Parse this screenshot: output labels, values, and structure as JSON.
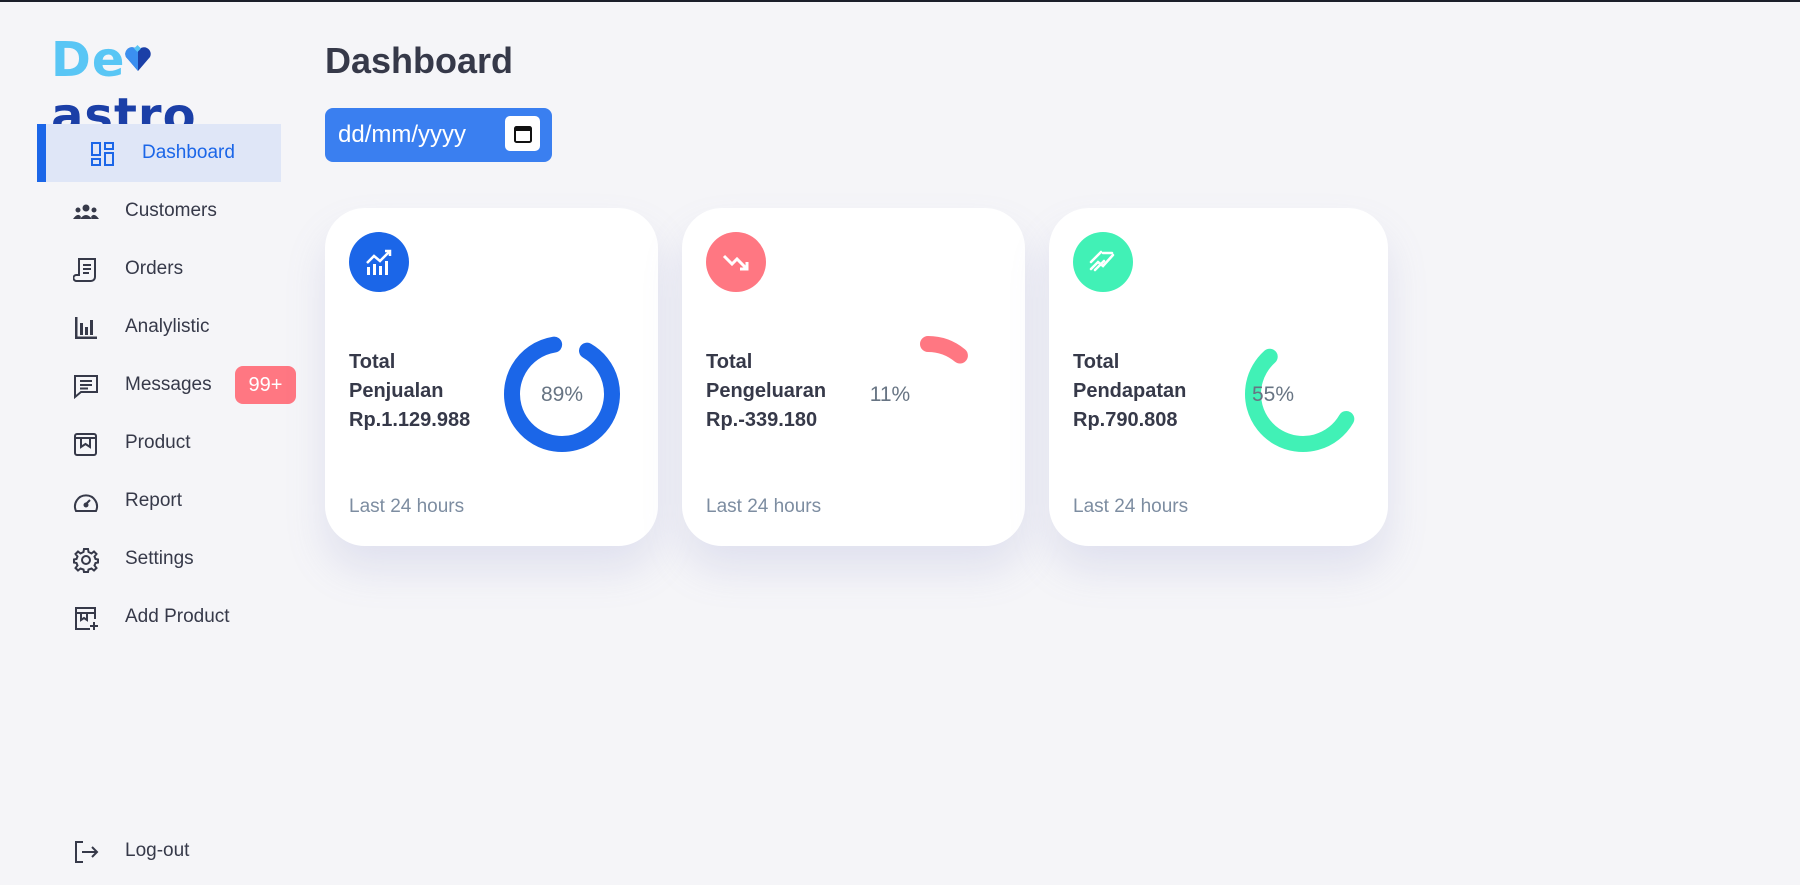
{
  "logo": {
    "part1": "De",
    "part2": "astro",
    "dot": "."
  },
  "nav": [
    {
      "label": "Dashboard",
      "icon": "grid-icon"
    },
    {
      "label": "Customers",
      "icon": "users-icon"
    },
    {
      "label": "Orders",
      "icon": "receipt-icon"
    },
    {
      "label": "Analylistic",
      "icon": "bar-chart-icon"
    },
    {
      "label": "Messages",
      "icon": "message-icon",
      "badge": "99+"
    },
    {
      "label": "Product",
      "icon": "product-icon"
    },
    {
      "label": "Report",
      "icon": "report-icon"
    },
    {
      "label": "Settings",
      "icon": "gear-icon"
    },
    {
      "label": "Add Product",
      "icon": "add-product-icon"
    }
  ],
  "logout": {
    "label": "Log-out",
    "icon": "logout-icon"
  },
  "header": {
    "title": "Dashboard"
  },
  "date_input": {
    "placeholder": "dd/mm/yyyy"
  },
  "cards": [
    {
      "line1": "Total",
      "line2": "Penjualan",
      "amount": "Rp.1.129.988",
      "percent": "89%",
      "progress": 0.89,
      "footer": "Last 24 hours",
      "color": "#1b66e8",
      "icon": "analytics-icon"
    },
    {
      "line1": "Total",
      "line2": "Pengeluaran",
      "amount": "Rp.-339.180",
      "percent": "11%",
      "progress": 0.11,
      "footer": "Last 24 hours",
      "color": "#ff7782",
      "icon": "trending-down-icon"
    },
    {
      "line1": "Total",
      "line2": "Pendapatan",
      "amount": "Rp.790.808",
      "percent": "55%",
      "progress": 0.55,
      "footer": "Last 24 hours",
      "color": "#41f1b6",
      "icon": "trending-up-icon"
    }
  ],
  "colors": {
    "primary": "#1b66e8",
    "danger": "#ff7782",
    "success": "#41f1b6"
  }
}
